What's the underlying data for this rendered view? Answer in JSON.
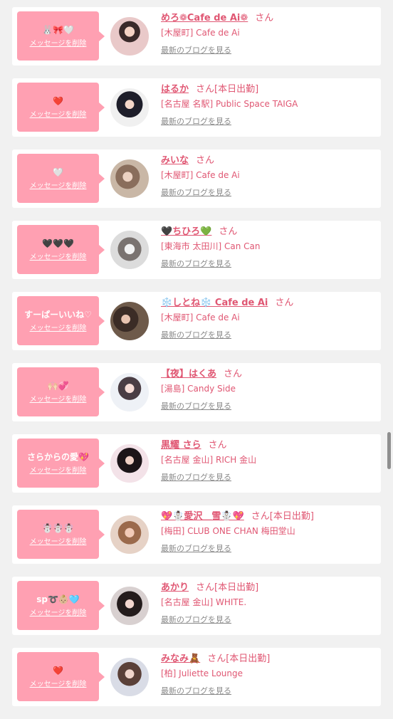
{
  "delete_label": "メッセージを削除",
  "blog_label": "最新のブログを見る",
  "san_suffix": "さん",
  "today_badge": "[本日出勤]",
  "colors": {
    "accent": "#e05773",
    "bubble": "#ffa0b2",
    "card": "#ffffff",
    "background": "#f1f1f1"
  },
  "cards": [
    {
      "message": "🐰🎀🤍",
      "name": "めろ❁Cafe de Ai❁",
      "today": "",
      "shop": "[木屋町] Cafe de Ai",
      "avatar_icon": "girl-photo"
    },
    {
      "message": "❤️",
      "name": "はるか",
      "today": "[本日出勤]",
      "shop": "[名古屋 名駅] Public Space TAIGA",
      "avatar_icon": "girl-photo"
    },
    {
      "message": "🤍",
      "name": "みいな",
      "today": "",
      "shop": "[木屋町] Cafe de Ai",
      "avatar_icon": "girl-photo"
    },
    {
      "message": "🖤🖤🖤",
      "name": "🖤ちひろ💚",
      "today": "",
      "shop": "[東海市 太田川] Can Can",
      "avatar_icon": "girl-photo"
    },
    {
      "message": "すーぱーいいね♡",
      "name": "❄️しとね❄️ Cafe de Ai",
      "today": "",
      "shop": "[木屋町] Cafe de Ai",
      "avatar_icon": "girl-photo"
    },
    {
      "message": "🙌🏻💞",
      "name": "【夜】はくあ",
      "today": "",
      "shop": "[湯島] Candy Side",
      "avatar_icon": "girl-photo"
    },
    {
      "message": "さらからの愛💖",
      "name": "黒耀 さら",
      "today": "",
      "shop": "[名古屋 金山] RICH 金山",
      "avatar_icon": "girl-photo"
    },
    {
      "message": "☃️☃️☃️",
      "name": "💖☃️愛沢＿雪☃️💖",
      "today": "[本日出勤]",
      "shop": "[梅田] CLUB ONE CHAN 梅田堂山",
      "avatar_icon": "girl-photo"
    },
    {
      "message": "sp➰👶🏼🩵",
      "name": "あかり",
      "today": "[本日出勤]",
      "shop": "[名古屋 金山] WHITE.",
      "avatar_icon": "girl-photo"
    },
    {
      "message": "❤️",
      "name": "みなみ🧸",
      "today": "[本日出勤]",
      "shop": "[柏] Juliette Lounge",
      "avatar_icon": "girl-photo"
    }
  ]
}
